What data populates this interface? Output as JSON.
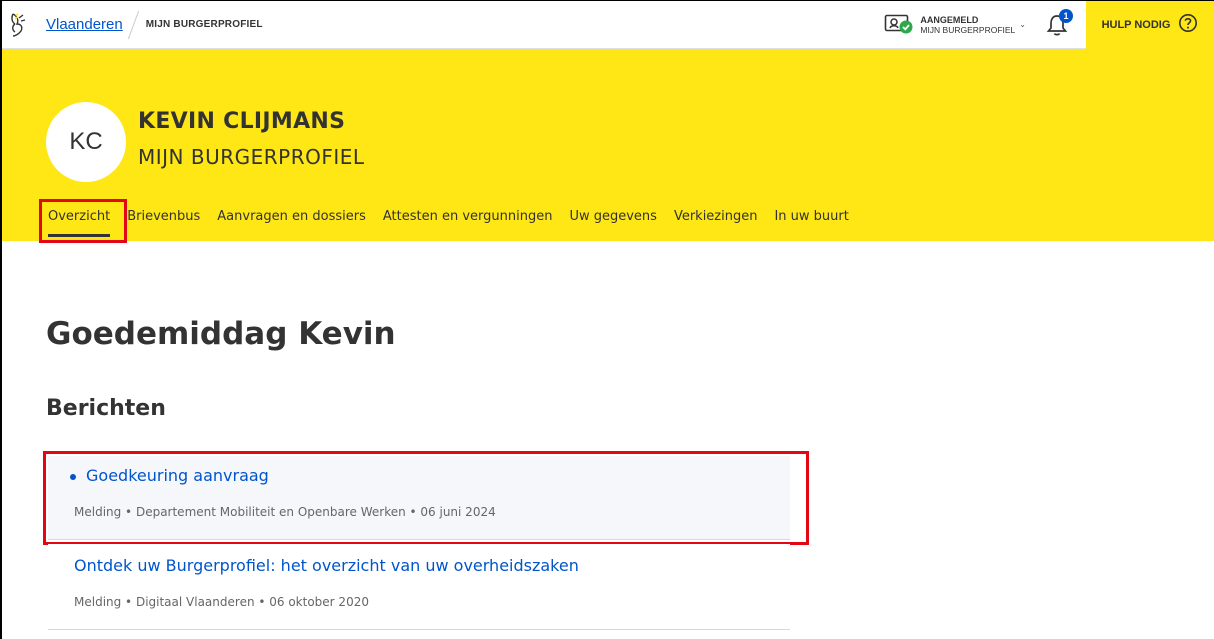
{
  "topbar": {
    "home_link": "Vlaanderen",
    "breadcrumb": "MIJN BURGERPROFIEL",
    "account_status": "AANGEMELD",
    "account_name": "MIJN BURGERPROFIEL",
    "notification_count": "1",
    "help_label": "HULP NODIG",
    "icons": {
      "logo": "flemish-lion-icon",
      "account": "id-card-check-icon",
      "bell": "bell-icon",
      "help": "question-circle-icon",
      "chevron": "chevron-down-icon"
    }
  },
  "profile": {
    "initials": "KC",
    "name": "KEVIN CLIJMANS",
    "subtitle": "MIJN BURGERPROFIEL"
  },
  "tabs": [
    {
      "label": "Overzicht",
      "active": true
    },
    {
      "label": "Brievenbus"
    },
    {
      "label": "Aanvragen en dossiers"
    },
    {
      "label": "Attesten en vergunningen"
    },
    {
      "label": "Uw gegevens"
    },
    {
      "label": "Verkiezingen"
    },
    {
      "label": "In uw buurt"
    }
  ],
  "main": {
    "greeting": "Goedemiddag Kevin",
    "section_title": "Berichten",
    "messages": [
      {
        "title": "Goedkeuring aanvraag",
        "unread": true,
        "meta": "Melding • Departement Mobiliteit en Openbare Werken • 06 juni 2024"
      },
      {
        "title": "Ontdek uw Burgerprofiel: het overzicht van uw overheidszaken",
        "unread": false,
        "meta": "Melding • Digitaal Vlaanderen • 06 oktober 2020"
      }
    ]
  },
  "colors": {
    "brand_yellow": "#ffe615",
    "link_blue": "#0055cc",
    "highlight_red": "#e30613",
    "text": "#333333"
  }
}
